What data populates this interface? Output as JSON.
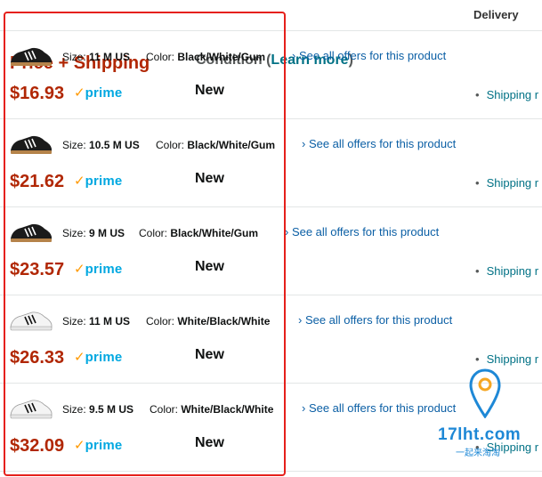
{
  "header": {
    "price_shipping": "Price + Shipping",
    "condition": "Condition (",
    "learn_more": "Learn more",
    "condition_close": ")",
    "delivery": "Delivery"
  },
  "labels": {
    "size": "Size:",
    "color": "Color:",
    "see_all": "› See all offers for this product",
    "prime_check": "✓",
    "prime_word": "prime"
  },
  "offers": [
    {
      "size": "11 M US",
      "color": "Black/White/Gum",
      "price": "$16.93",
      "condition": "New",
      "shipping": "Shipping r",
      "shoe_color": "black"
    },
    {
      "size": "10.5 M US",
      "color": "Black/White/Gum",
      "price": "$21.62",
      "condition": "New",
      "shipping": "Shipping r",
      "shoe_color": "black"
    },
    {
      "size": "9 M US",
      "color": "Black/White/Gum",
      "price": "$23.57",
      "condition": "New",
      "shipping": "Shipping r",
      "shoe_color": "black"
    },
    {
      "size": "11 M US",
      "color": "White/Black/White",
      "price": "$26.33",
      "condition": "New",
      "shipping": "Shipping r",
      "shoe_color": "white"
    },
    {
      "size": "9.5 M US",
      "color": "White/Black/White",
      "price": "$32.09",
      "condition": "New",
      "shipping": "Shipping r",
      "shoe_color": "white"
    }
  ],
  "watermark": {
    "brand": "17lht.com",
    "sub": "一起来淘淘"
  },
  "colors": {
    "price": "#b12704",
    "link": "#007185",
    "prime": "#00a8e1",
    "highlight": "#e5201b"
  }
}
